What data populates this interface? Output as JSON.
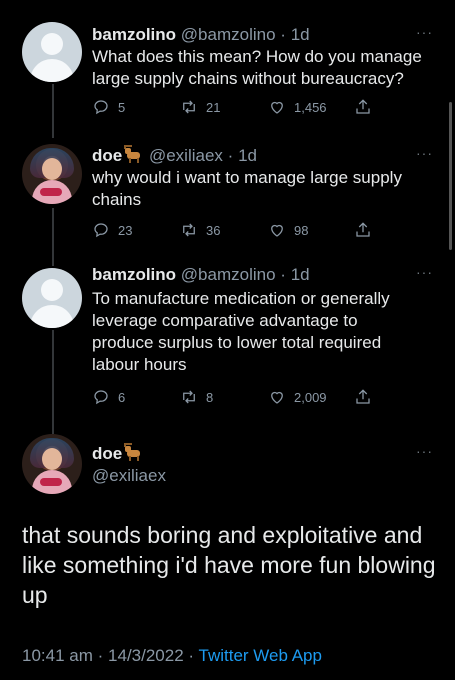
{
  "tweets": [
    {
      "name": "bamzolino",
      "handle": "@bamzolino",
      "separator": "·",
      "time": "1d",
      "text": "What does this mean? How do you manage large supply chains without bureaucracy?",
      "replies": "5",
      "retweets": "21",
      "likes": "1,456"
    },
    {
      "name": "doe",
      "handle": "@exiliaex",
      "separator": "·",
      "time": "1d",
      "text": "why would i want to manage large supply chains",
      "replies": "23",
      "retweets": "36",
      "likes": "98"
    },
    {
      "name": "bamzolino",
      "handle": "@bamzolino",
      "separator": "·",
      "time": "1d",
      "text": "To manufacture medication or generally leverage comparative advantage to produce surplus to lower total required labour hours",
      "replies": "6",
      "retweets": "8",
      "likes": "2,009"
    }
  ],
  "focused": {
    "name": "doe",
    "handle": "@exiliaex",
    "text": "that sounds boring and exploitative and like something i'd have more fun blowing up",
    "time": "10:41 am",
    "separator": "·",
    "date": "14/3/2022",
    "app": "Twitter Web App"
  },
  "more_label": "···",
  "icons": {
    "reply": "reply-icon",
    "retweet": "retweet-icon",
    "like": "like-icon",
    "share": "share-icon",
    "more": "more-icon"
  },
  "colors": {
    "background": "#000000",
    "text": "#e7e9ea",
    "muted": "#8b98a5",
    "link": "#1d9bf0"
  }
}
